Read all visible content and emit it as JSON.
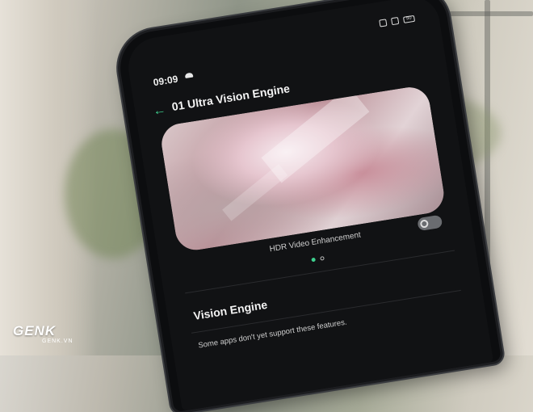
{
  "status_bar": {
    "time": "09:09",
    "battery": "50"
  },
  "header": {
    "back_glyph": "←",
    "title": "01 Ultra Vision Engine"
  },
  "banner": {
    "caption": "HDR Video Enhancement",
    "toggle_on": false
  },
  "pager": {
    "current": 1,
    "total": 2
  },
  "section": {
    "title": "Vision Engine",
    "note": "Some apps don't yet support these features."
  },
  "watermark": {
    "brand": "GENK",
    "site": "GENK.VN"
  },
  "colors": {
    "accent": "#3ecf8e",
    "screen_bg": "#111214",
    "text_primary": "#f4f4f4"
  }
}
